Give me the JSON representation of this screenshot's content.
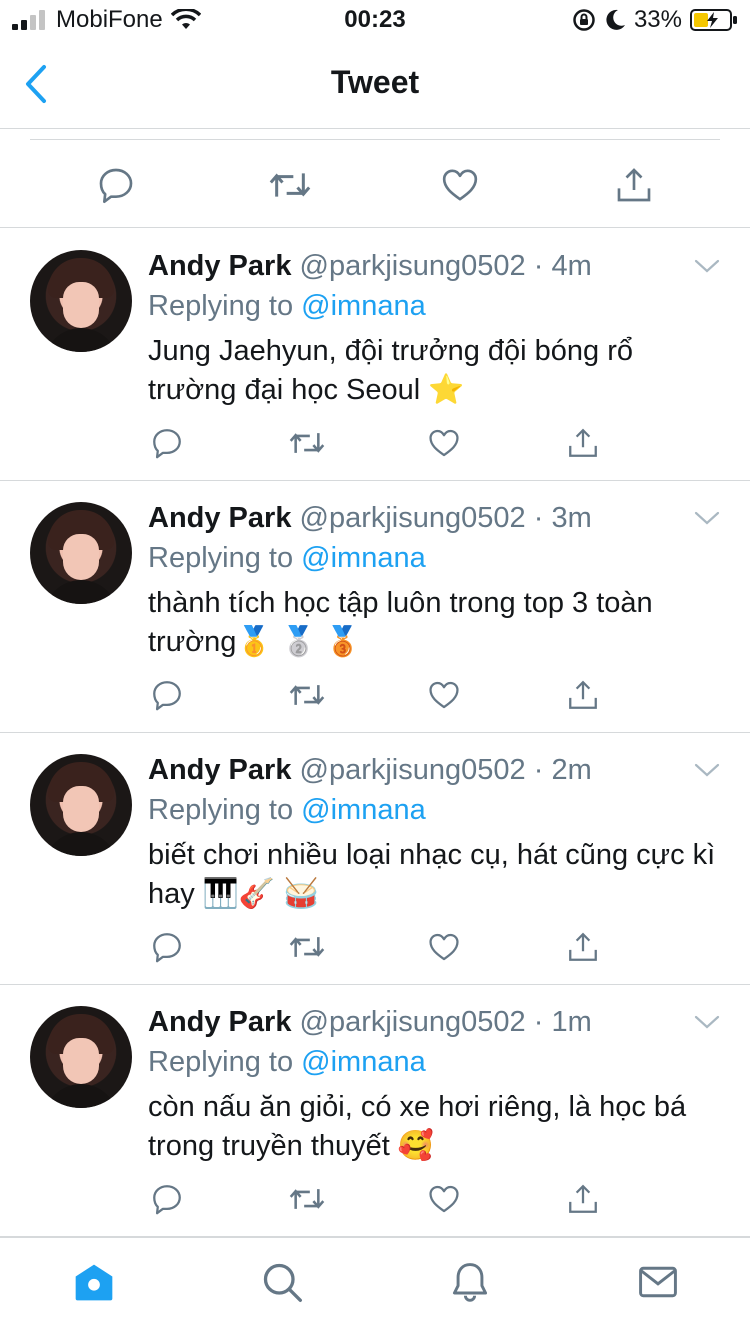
{
  "status_bar": {
    "carrier": "MobiFone",
    "time": "00:23",
    "battery": "33%"
  },
  "header": {
    "title": "Tweet"
  },
  "colors": {
    "accent": "#1da1f2",
    "secondary_text": "#657786",
    "divider": "#d6d9db",
    "battery": "#f5c700"
  },
  "tweets": [
    {
      "name": "Andy Park",
      "handle": "@parkjisung0502",
      "separator": "·",
      "age": "4m",
      "replying_label": "Replying to",
      "mention": "@imnana",
      "text": "Jung Jaehyun, đội trưởng đội bóng rổ trường đại học Seoul ⭐"
    },
    {
      "name": "Andy Park",
      "handle": "@parkjisung0502",
      "separator": "·",
      "age": "3m",
      "replying_label": "Replying to",
      "mention": "@imnana",
      "text": "thành tích học tập luôn trong top 3 toàn trường🥇 🥈 🥉"
    },
    {
      "name": "Andy Park",
      "handle": "@parkjisung0502",
      "separator": "·",
      "age": "2m",
      "replying_label": "Replying to",
      "mention": "@imnana",
      "text": "biết chơi nhiều loại nhạc cụ, hát cũng cực kì hay 🎹🎸 🥁"
    },
    {
      "name": "Andy Park",
      "handle": "@parkjisung0502",
      "separator": "·",
      "age": "1m",
      "replying_label": "Replying to",
      "mention": "@imnana",
      "text": "còn nấu ăn giỏi, có xe hơi riêng, là học bá trong truyền thuyết 🥰"
    }
  ],
  "icons": {
    "reply": "reply-icon",
    "retweet": "retweet-icon",
    "like": "heart-icon",
    "share": "share-icon",
    "tabs": [
      "home-icon",
      "search-icon",
      "bell-icon",
      "mail-icon"
    ]
  }
}
